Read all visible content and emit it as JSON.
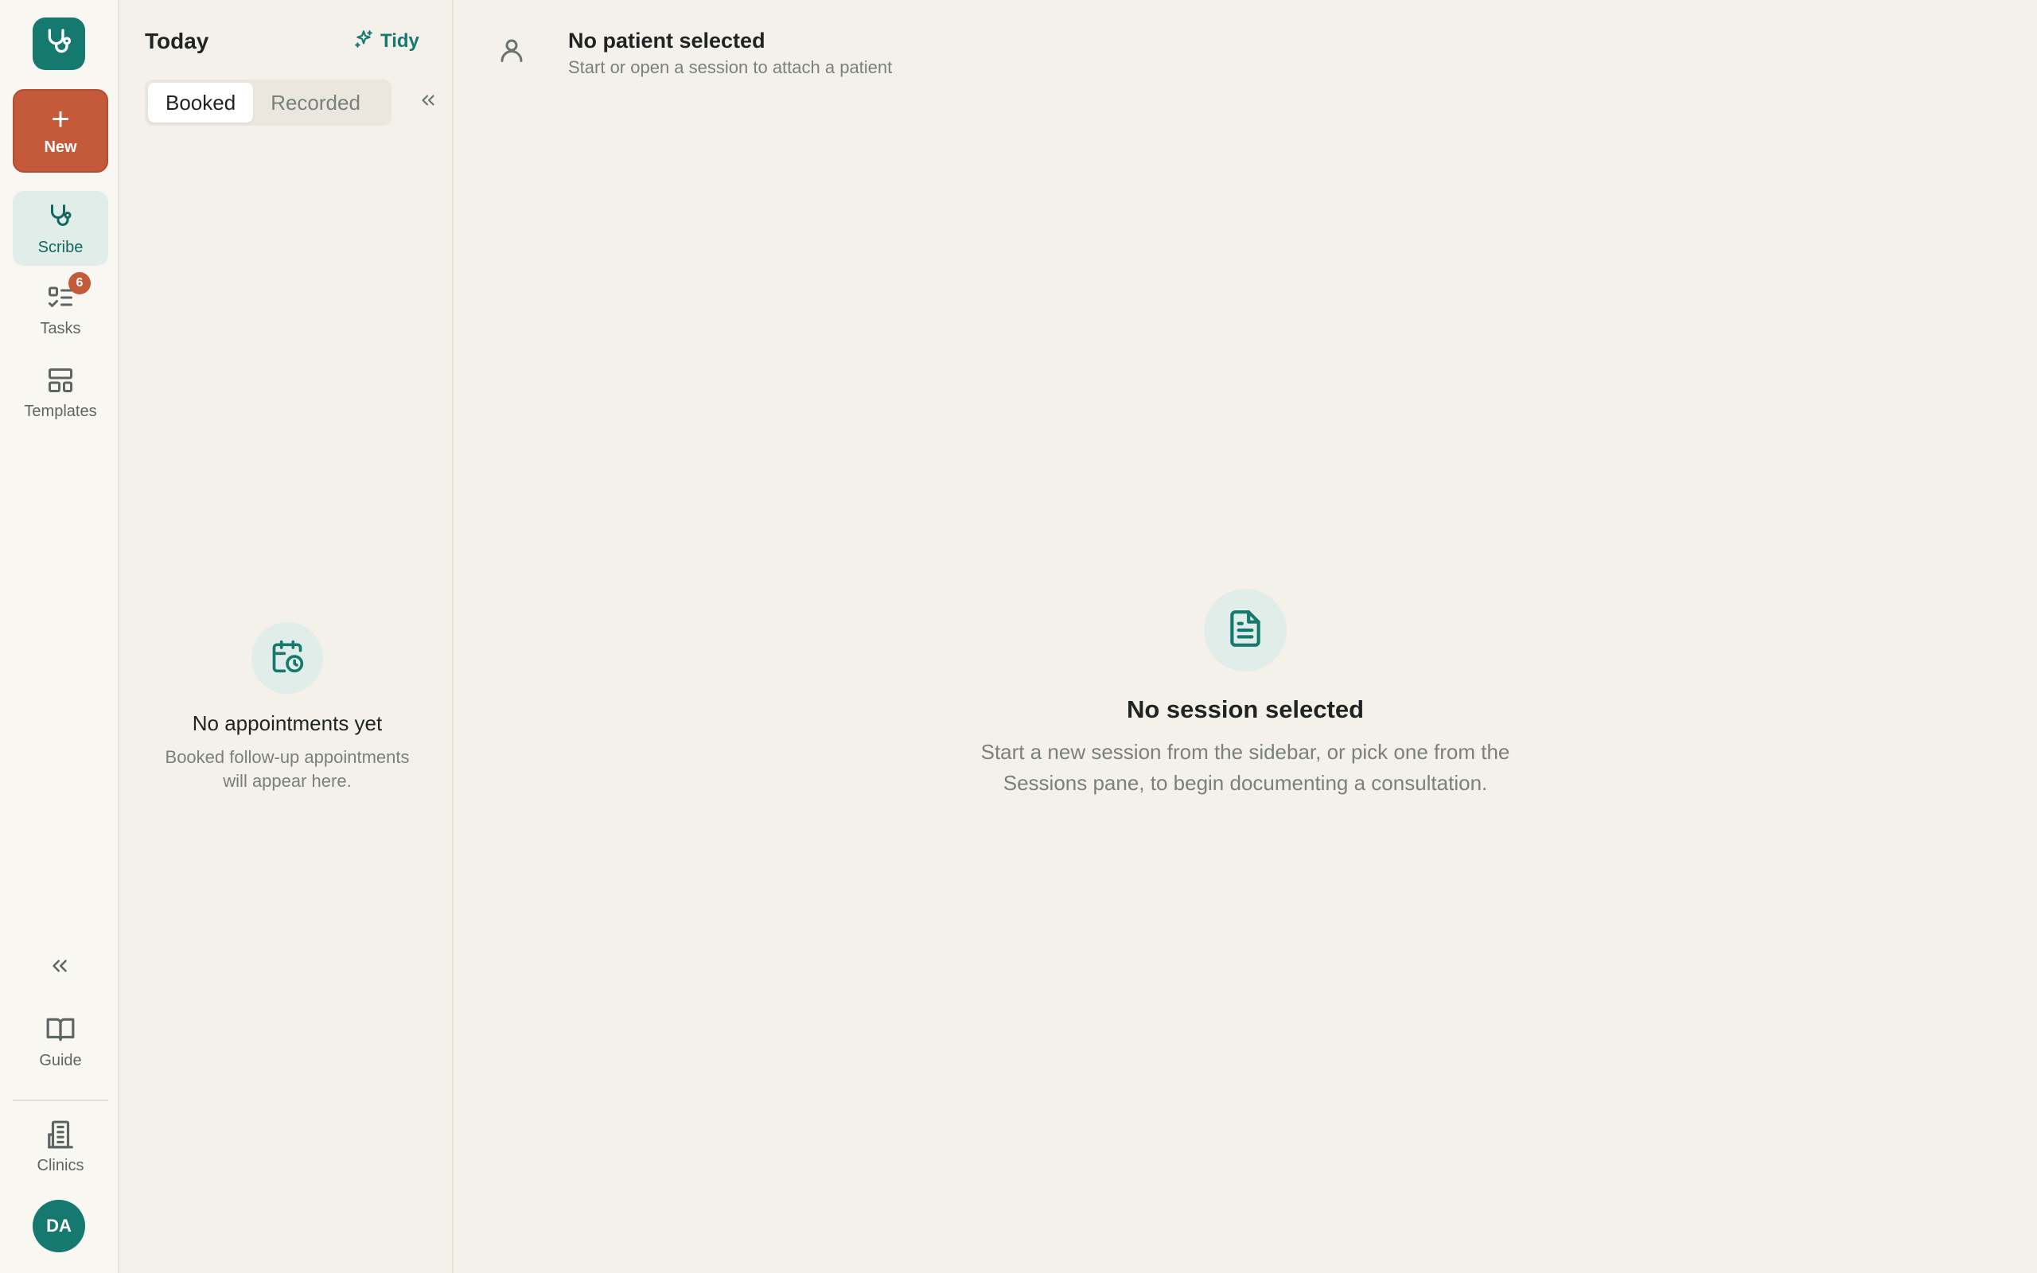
{
  "rail": {
    "new_label": "New",
    "items": [
      {
        "label": "Scribe",
        "icon": "stethoscope-icon"
      },
      {
        "label": "Tasks",
        "icon": "tasks-icon",
        "badge": "6"
      },
      {
        "label": "Templates",
        "icon": "templates-icon"
      }
    ],
    "bottom": [
      {
        "label": "Guide",
        "icon": "book-icon"
      },
      {
        "label": "Clinics",
        "icon": "building-icon"
      }
    ],
    "avatar_initials": "DA"
  },
  "pane": {
    "title": "Today",
    "tidy_label": "Tidy",
    "tabs": [
      "Booked",
      "Recorded"
    ],
    "active_tab": "Booked",
    "empty_title": "No appointments yet",
    "empty_desc": "Booked follow-up appointments will appear here."
  },
  "header": {
    "patient_title": "No patient selected",
    "patient_subtitle": "Start or open a session to attach a patient"
  },
  "main": {
    "empty_title": "No session selected",
    "empty_desc": "Start a new session from the sidebar, or pick one from the Sessions pane, to begin documenting a consultation."
  },
  "colors": {
    "brand": "#15796f",
    "accent": "#c55a3a",
    "background": "#f4f1ea"
  }
}
